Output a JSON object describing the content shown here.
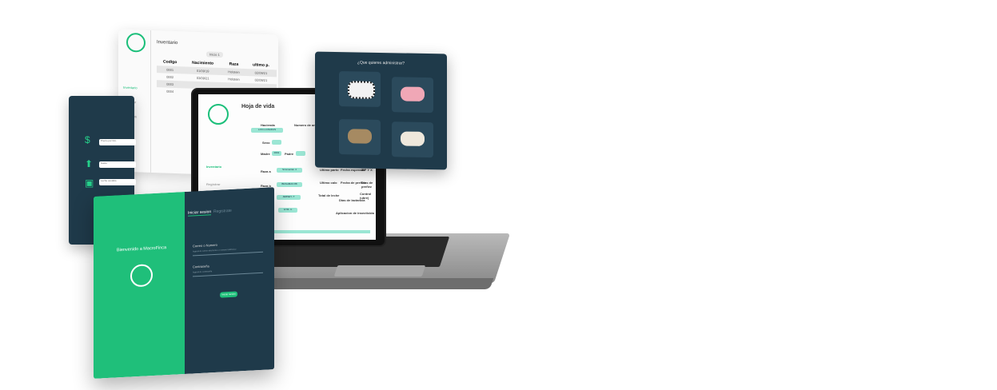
{
  "inventory": {
    "title": "Inventario",
    "controls": "Inicio 1",
    "columns": [
      "Codigo",
      "Nacimiento",
      "Raza",
      "ultimo p."
    ],
    "rows": [
      [
        "0001",
        "01/09/19",
        "Holstein",
        "02/09/21"
      ],
      [
        "0002",
        "03/09/21",
        "Holstein",
        "02/09/21"
      ],
      [
        "0003",
        "",
        "",
        ""
      ],
      [
        "0004",
        "",
        "",
        ""
      ]
    ],
    "nav": [
      "Inventario",
      "Registrar",
      "Registros"
    ]
  },
  "finance_panel": {
    "fields": [
      "Precio por litro",
      "Gasto",
      "Leche vendido"
    ]
  },
  "laptop_screen": {
    "title": "Hoja de vida",
    "sidebar_item": "Inventario",
    "sidebar_item_2": "Registrar",
    "labels": {
      "hacienda": "Hacienda",
      "numero": "Numero de animal",
      "sexo": "Sexo",
      "madre": "Madre",
      "padre": "Padre",
      "raza_a": "Raza a",
      "raza_b": "Raza b",
      "ultimo_parto": "Ultimo parto",
      "ultimo_calo": "Ultimo calo",
      "total_leche": "Total de leche",
      "fecha_esperada": "Fecha esperada",
      "fecha_preñez": "Fecha de preñez",
      "dias_lactancia": "Dias de lactancia",
      "aplicacion": "Aplicacion de insecticida",
      "iep": "IEP Y X",
      "dias_preñez": "Dias de preñez",
      "control": "Control (ubre)"
    },
    "values": {
      "hacienda": "LAS LLANADAS",
      "madre": "0001",
      "raza_1": "Simmental- 4",
      "raza_2": "BRAHMAN 88",
      "raza_3": "JERSEY- T",
      "raza_4": "GYR- C"
    }
  },
  "chooser": {
    "question": "¿Que quieres administrar?",
    "animals": [
      "cow-holstein",
      "pig",
      "cattle-brown",
      "sheep"
    ]
  },
  "login": {
    "welcome": "Bienvenido a MacroFinca",
    "tab_login": "Iniciar sesion",
    "tab_register": "Registrate",
    "email_label": "Correo o Numero",
    "email_placeholder": "Ingresa tu correo electronico o numero telefonico",
    "password_label": "Contraseña",
    "password_placeholder": "Ingresa tu contraseña",
    "submit": "Iniciar sesion"
  }
}
